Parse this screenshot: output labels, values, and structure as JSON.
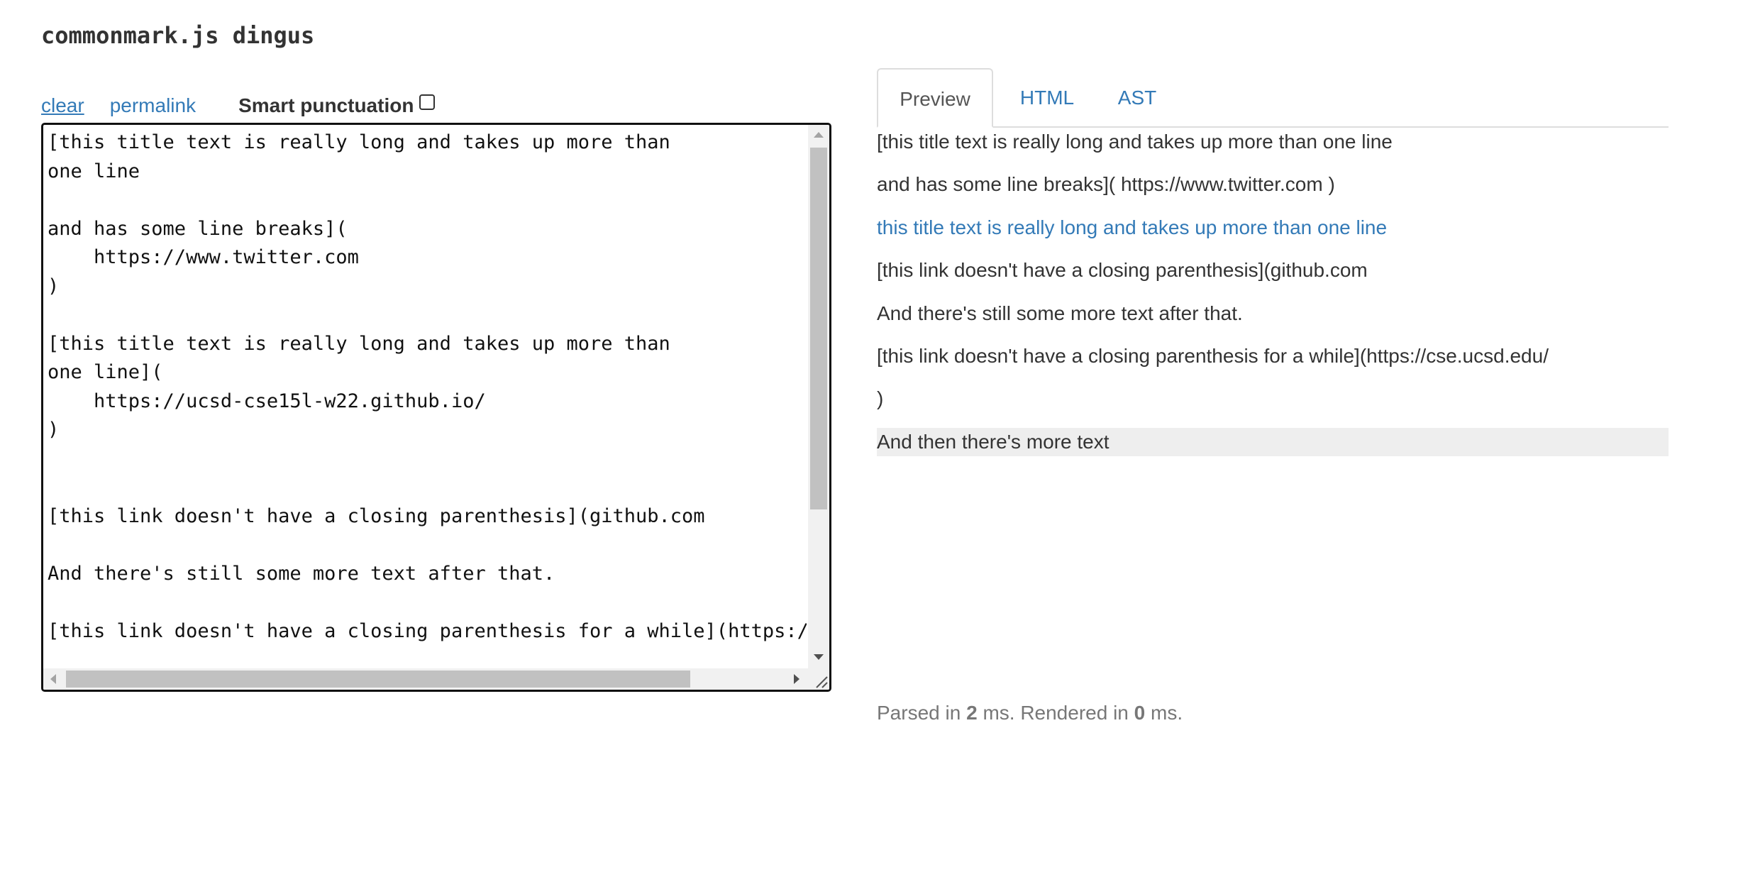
{
  "app": {
    "title": "commonmark.js dingus"
  },
  "toolbar": {
    "clear_label": "clear",
    "permalink_label": "permalink",
    "smart_punctuation_label": "Smart punctuation",
    "smart_punctuation_checked": false
  },
  "editor": {
    "text": "[this title text is really long and takes up more than\none line\n\nand has some line breaks](\n    https://www.twitter.com\n)\n\n[this title text is really long and takes up more than\none line](\n    https://ucsd-cse15l-w22.github.io/\n)\n\n\n[this link doesn't have a closing parenthesis](github.com\n\nAnd there's still some more text after that.\n\n[this link doesn't have a closing parenthesis for a while](https://cse.ucsd.edu/"
  },
  "tabs": [
    {
      "label": "Preview",
      "active": true
    },
    {
      "label": "HTML",
      "active": false
    },
    {
      "label": "AST",
      "active": false
    }
  ],
  "preview": {
    "p1": "[this title text is really long and takes up more than one line",
    "p2": "and has some line breaks]( https://www.twitter.com )",
    "link": "this title text is really long and takes up more than one line",
    "p3": "[this link doesn't have a closing parenthesis](github.com",
    "p4": "And there's still some more text after that.",
    "p5": "[this link doesn't have a closing parenthesis for a while](https://cse.ucsd.edu/",
    "p6": ")",
    "p7": "And then there's more text"
  },
  "timing": {
    "parsed_prefix": "Parsed in",
    "parsed_ms": "2",
    "ms_rendered_prefix": "ms. Rendered in",
    "rendered_ms": "0",
    "ms_suffix": "ms."
  },
  "colors": {
    "link": "#337ab7",
    "text": "#333333",
    "muted": "#777777",
    "highlight": "#eeeeee",
    "tab_border": "#dddddd"
  }
}
